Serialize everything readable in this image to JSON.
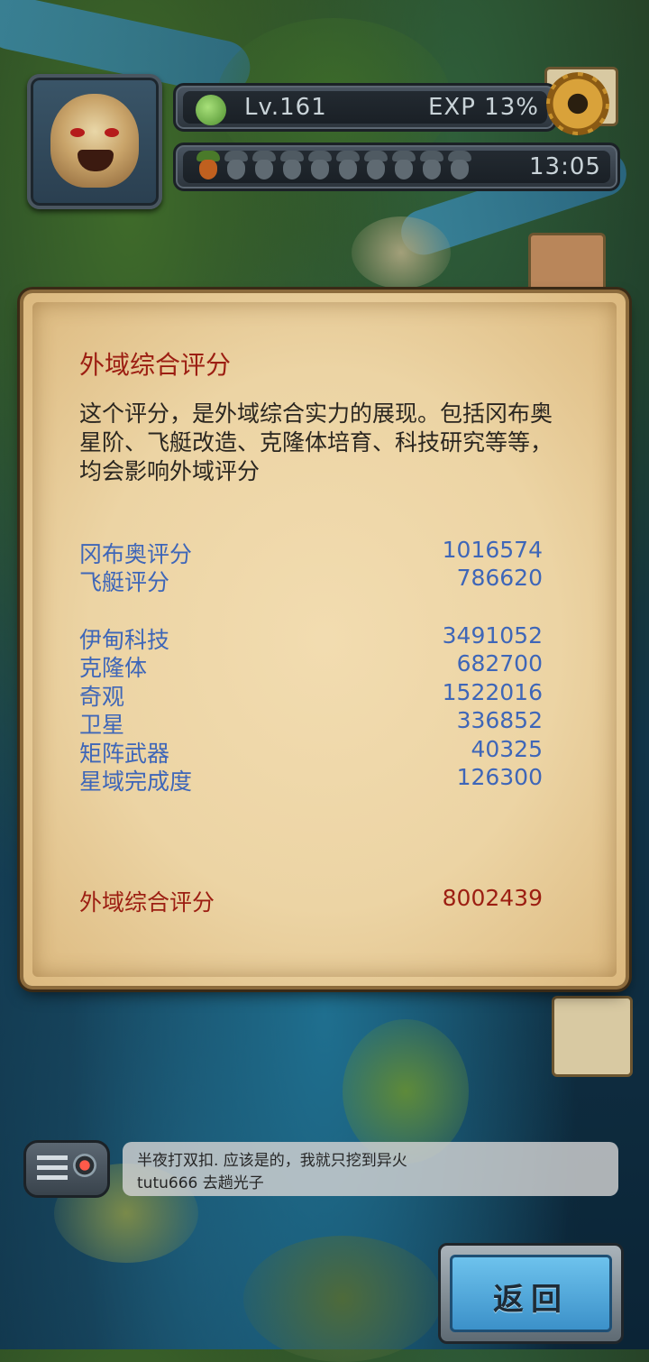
{
  "hud": {
    "level": "Lv.161",
    "exp": "EXP 13%",
    "timer": "13:05",
    "energy_total": 10,
    "energy_filled": 1
  },
  "panel": {
    "title": "外域综合评分",
    "description": "这个评分，是外域综合实力的展现。包括冈布奥星阶、飞艇改造、克隆体培育、科技研究等等，均会影响外域评分",
    "group1": [
      {
        "label": "冈布奥评分",
        "value": "1016574"
      },
      {
        "label": "飞艇评分",
        "value": "786620"
      }
    ],
    "group2": [
      {
        "label": "伊甸科技",
        "value": "3491052"
      },
      {
        "label": "克隆体",
        "value": "682700"
      },
      {
        "label": "奇观",
        "value": "1522016"
      },
      {
        "label": "卫星",
        "value": "336852"
      },
      {
        "label": "矩阵武器",
        "value": "40325"
      },
      {
        "label": "星域完成度",
        "value": "126300"
      }
    ],
    "total": {
      "label": "外域综合评分",
      "value": "8002439"
    }
  },
  "chat": {
    "line1": "半夜打双扣. 应该是的，我就只挖到异火",
    "line2": "tutu666 去趟光子"
  },
  "back_button": {
    "label": "返回"
  },
  "colors": {
    "title_red": "#9c1e12",
    "value_blue": "#3e66b8",
    "parchment": "#ecd4a4"
  }
}
